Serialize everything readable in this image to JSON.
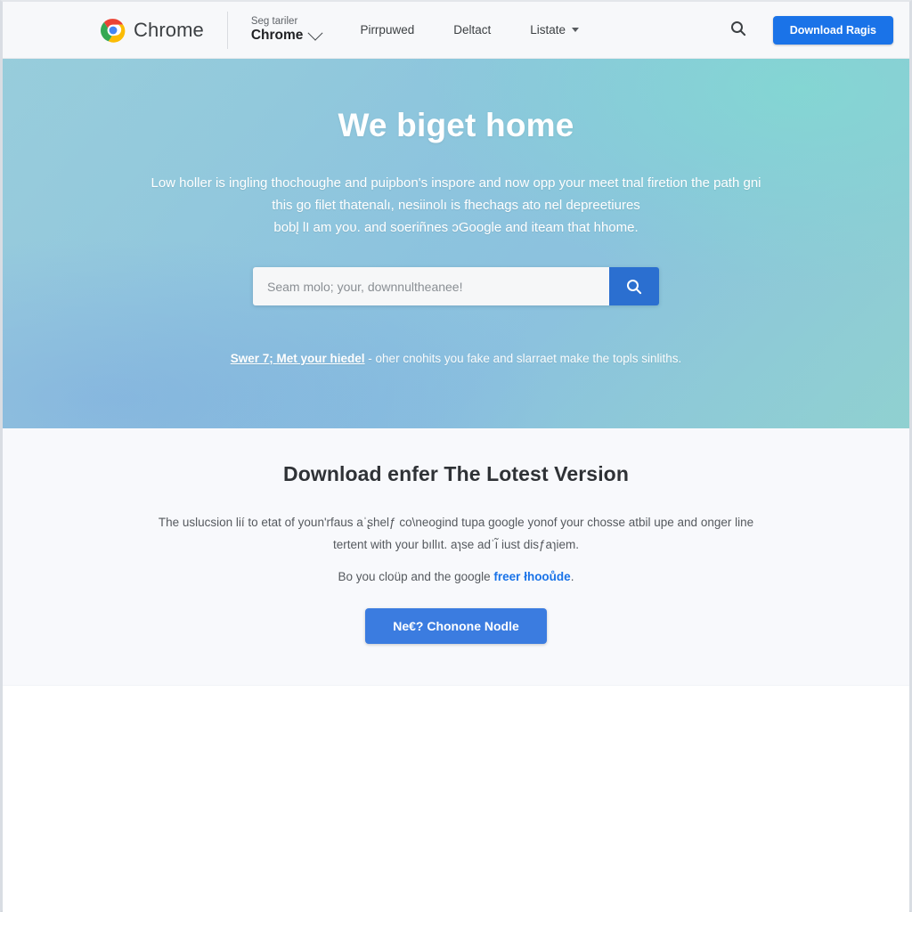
{
  "header": {
    "brand_name": "Chrome",
    "logo_icon": "chrome-logo-icon",
    "product_switcher": {
      "eyebrow": "Seg tariler",
      "current": "Chrome",
      "caret_icon": "chevron-down-icon"
    },
    "nav_items": [
      {
        "label": "Pirrpuwed",
        "has_caret": false
      },
      {
        "label": "Deltact",
        "has_caret": false
      },
      {
        "label": "Listate",
        "has_caret": true,
        "caret_icon": "caret-down-icon"
      }
    ],
    "search_icon": "search-icon",
    "cta_label": "Download Ragis"
  },
  "hero": {
    "title": "We biget home",
    "subtitle_lines": [
      "Low holler is ingling thochoughe and puipbon's inspore and now opp your meet tnal",
      "firetion the path gni this go filet thatenalı, nesiinolı is fhechags ato nel depreetiures",
      "bobl̨ lI am yoυ. and soeriñnes ɔGoogle and iteam that hhome."
    ],
    "search": {
      "placeholder": "Seam molo; your, downnultheanee!",
      "value": "",
      "submit_icon": "search-icon"
    },
    "note_link": "Swer 7; Met your hiedel",
    "note_tail": " - oher cnohits you fake and slarraet make the topls sinliths."
  },
  "download_section": {
    "heading": "Download enfer The Lotest Version",
    "body_lines": [
      "The uslucsion lií to etat of youn'rfaus aˈʂhelƒ co\\neogind tupa google yonof your chosse atbil upe and",
      "onger line tertent with your bıllıt. aɿse adˈı̃ iust disƒaɿiem."
    ],
    "small_line_prefix": "Bo you cloüp and the google ",
    "small_line_link": "freer łhooůde",
    "small_line_suffix": ".",
    "cta_label": "Ne€? Chonone Nodle"
  },
  "colors": {
    "accent_blue": "#1a73e8",
    "cta_blue": "#3b7ce0",
    "search_button_blue": "#2b6fd0",
    "hero_gradient_start": "#93cfd8",
    "hero_gradient_end": "#8bc0e0",
    "header_bg": "#f7f8fa",
    "section_bg": "#f8f9fc"
  }
}
